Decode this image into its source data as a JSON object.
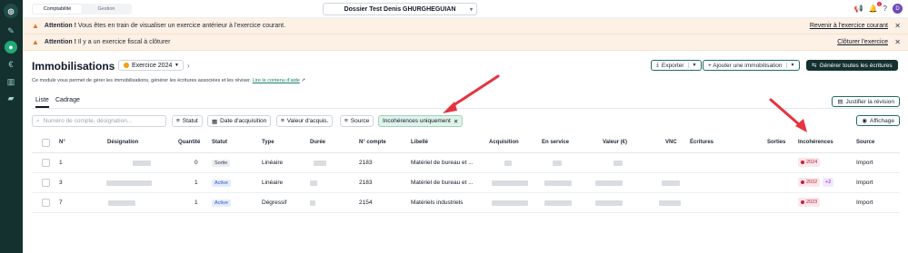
{
  "topbar": {
    "segments": [
      "Comptabilité",
      "Gestion"
    ],
    "dossier": "Dossier Test Denis GHURGHEGUIAN",
    "notif_count": "2",
    "avatar_initial": "D"
  },
  "banners": [
    {
      "prefix": "Attention !",
      "text": " Vous êtes en train de visualiser un exercice antérieur à l'exercice courant.",
      "action": "Revenir à l'exercice courant"
    },
    {
      "prefix": "Attention !",
      "text": " Il y a un exercice fiscal à clôturer",
      "action": "Clôturer l'exercice"
    }
  ],
  "header": {
    "title": "Immobilisations",
    "exercice": "Exercice 2024",
    "description": "Ce module vous permet de gérer les immobilisations, générer les écritures associées et les réviser.",
    "doc_link": "Lire le contenu d'aide",
    "export_label": "Exporter",
    "add_label": "+ Ajouter une immobilisation",
    "generate_label": "Générer toutes les écritures"
  },
  "tabs": {
    "liste": "Liste",
    "cadrage": "Cadrage",
    "justify": "Justifier la révision"
  },
  "filters": {
    "search_placeholder": "Numéro de compte, désignation...",
    "statut": "Statut",
    "date": "Date d'acquisition",
    "valeur": "Valeur d'acquis.",
    "source": "Source",
    "incoherences": "Incohérences uniquement",
    "affichage": "Affichage"
  },
  "table": {
    "headers": [
      "N°",
      "Désignation",
      "Quantité",
      "Statut",
      "Type",
      "Durée",
      "N° compte",
      "Libellé",
      "Acquisition",
      "En service",
      "Valeur (€)",
      "VNC",
      "Écritures",
      "Sorties",
      "Incohérences",
      "Source"
    ],
    "rows": [
      {
        "num": "1",
        "qty": "0",
        "statut": "Sortie",
        "type": "Linéaire",
        "compte": "2183",
        "libelle": "Matériel de bureau et ...",
        "incoherence": "2024",
        "extra": "",
        "source": "Import"
      },
      {
        "num": "3",
        "qty": "1",
        "statut": "Active",
        "type": "Linéaire",
        "compte": "2183",
        "libelle": "Matériel de bureau et ...",
        "incoherence": "2022",
        "extra": "+2",
        "source": "Import"
      },
      {
        "num": "7",
        "qty": "1",
        "statut": "Active",
        "type": "Dégressif",
        "compte": "2154",
        "libelle": "Matériels industriels",
        "incoherence": "2023",
        "extra": "",
        "source": "Import"
      }
    ]
  },
  "colors": {
    "sidebar": "#14302f",
    "accent": "#1ea975",
    "banner": "#fdf0e4",
    "arrow": "#e5343f"
  }
}
